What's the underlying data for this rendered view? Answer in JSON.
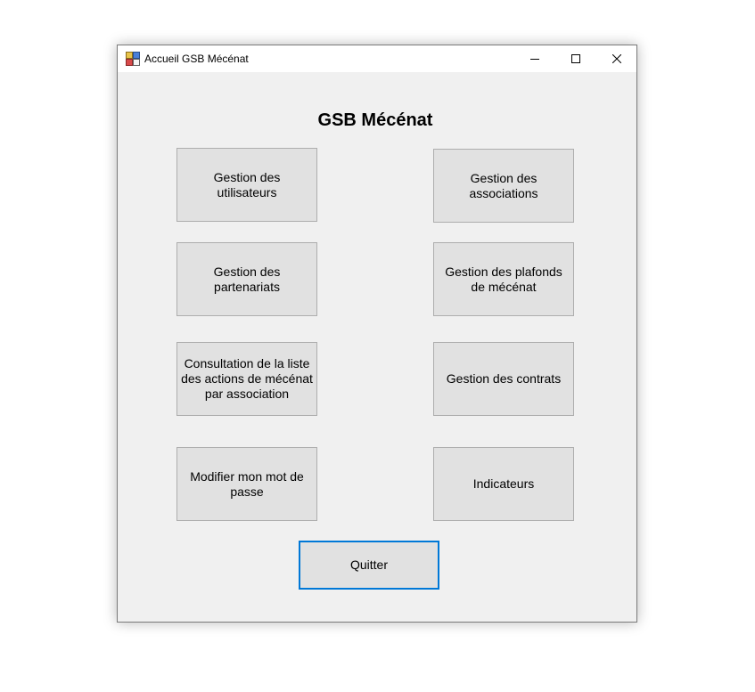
{
  "window": {
    "title": "Accueil GSB Mécénat"
  },
  "main": {
    "heading": "GSB Mécénat",
    "buttons": {
      "utilisateurs": "Gestion des utilisateurs",
      "associations": "Gestion des associations",
      "partenariats": "Gestion des partenariats",
      "plafonds": "Gestion des plafonds de mécénat",
      "consultation": "Consultation de la liste des actions de mécénat par association",
      "contrats": "Gestion des contrats",
      "mot_de_passe": "Modifier mon mot de passe",
      "indicateurs": "Indicateurs",
      "quitter": "Quitter"
    }
  },
  "icons": {
    "app": "app-icon",
    "minimize": "minimize-icon",
    "maximize": "maximize-icon",
    "close": "close-icon"
  },
  "colors": {
    "window_bg": "#f0f0f0",
    "button_bg": "#e1e1e1",
    "button_border": "#adadad",
    "focus_border": "#0078d7"
  }
}
